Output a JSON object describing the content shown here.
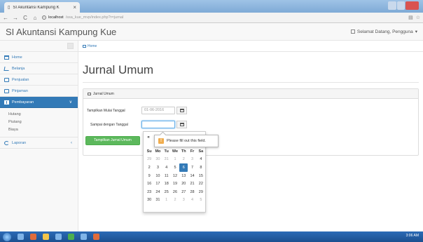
{
  "browser": {
    "tab_title": "SI Akuntansi Kampung K",
    "tab_close": "×",
    "nav": {
      "back": "←",
      "forward": "→",
      "reload": "C",
      "home": "⌂"
    },
    "url_host": "localhost",
    "url_path": "/ssa_kue_mvp/index.php?r=jurnal",
    "toolbar_right": [
      "▤",
      "☆"
    ]
  },
  "header": {
    "brand": "SI Akuntansi Kampung Kue",
    "user_greeting": "Selamat Datang, Pengguna",
    "user_caret": "▾"
  },
  "sidebar": {
    "items": [
      {
        "label": "Home",
        "icon": "home-icon"
      },
      {
        "label": "Belanja",
        "icon": "cart-icon"
      },
      {
        "label": "Penjualan",
        "icon": "box-icon"
      },
      {
        "label": "Pinjaman",
        "icon": "box-icon"
      },
      {
        "label": "Pembayaran",
        "icon": "grid-icon",
        "chevron": "∨"
      },
      {
        "label": "Laporan",
        "icon": "pie-icon",
        "chevron": "‹"
      }
    ],
    "subitems": [
      "Hutang",
      "Piutang",
      "Biaya"
    ]
  },
  "breadcrumb": {
    "home": "Home"
  },
  "main": {
    "title": "Jurnal Umum",
    "panel_title": "Jurnal Umum",
    "start_label": "Tampilkan Mulai Tanggal",
    "start_value": "01-06-2016",
    "end_label": "Sampai dengan Tanggal",
    "end_value": "",
    "submit_label": "Tampilkan Jurnal Umum"
  },
  "datepicker": {
    "prev": "«",
    "weekdays": [
      "Su",
      "Mo",
      "Tu",
      "We",
      "Th",
      "Fr",
      "Sa"
    ],
    "weeks": [
      [
        "29",
        "30",
        "31",
        "1",
        "2",
        "3",
        "4"
      ],
      [
        "2",
        "3",
        "4",
        "5",
        "6",
        "7",
        "8"
      ],
      [
        "9",
        "10",
        "11",
        "12",
        "13",
        "14",
        "15"
      ],
      [
        "16",
        "17",
        "18",
        "19",
        "20",
        "21",
        "22"
      ],
      [
        "23",
        "24",
        "25",
        "26",
        "27",
        "28",
        "29"
      ],
      [
        "30",
        "31",
        "1",
        "2",
        "3",
        "4",
        "5"
      ]
    ],
    "first_row_display": [
      "29",
      "30",
      "31",
      "1",
      "2",
      "3",
      "4"
    ],
    "selected": "6"
  },
  "tooltip": {
    "icon": "!",
    "text": "Please fill out this field."
  },
  "taskbar": {
    "time": "3:06 AM"
  },
  "colors": {
    "primary": "#337ab7",
    "success": "#5cb85c",
    "warning": "#f0ad4e"
  }
}
